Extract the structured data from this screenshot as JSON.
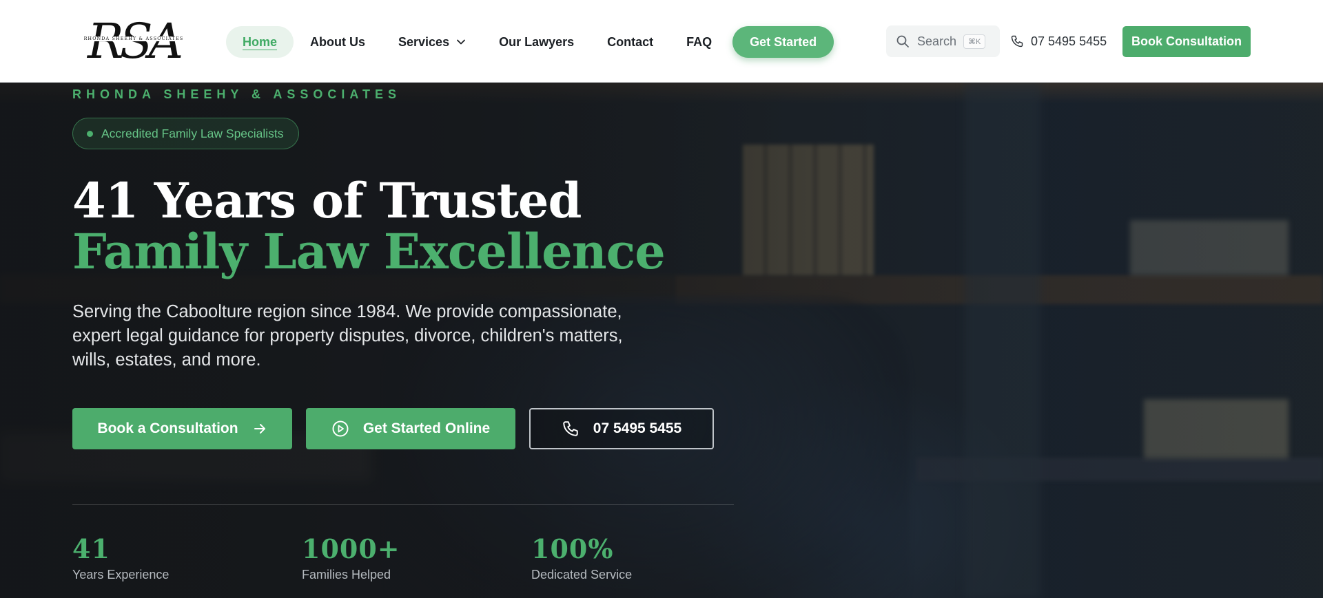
{
  "header": {
    "logo_monogram": "RSA",
    "logo_text": "RHONDA SHEEHY & ASSOCIATES",
    "nav": [
      {
        "label": "Home"
      },
      {
        "label": "About Us"
      },
      {
        "label": "Services"
      },
      {
        "label": "Our Lawyers"
      },
      {
        "label": "Contact"
      },
      {
        "label": "FAQ"
      }
    ],
    "nav_cta": "Get Started",
    "search_placeholder": "Search",
    "search_shortcut": "⌘K",
    "phone": "07 5495 5455",
    "book_button": "Book Consultation"
  },
  "hero": {
    "eyebrow": "RHONDA SHEEHY & ASSOCIATES",
    "badge": "Accredited Family Law Specialists",
    "title_line1": "41 Years of Trusted",
    "title_line2": "Family Law Excellence",
    "lead": "Serving the Caboolture region since 1984. We provide compassionate, expert legal guidance for property disputes, divorce, children's matters, wills, estates, and more.",
    "buttons": {
      "book": "Book a Consultation",
      "online": "Get Started Online",
      "call": "07 5495 5455"
    },
    "stats": [
      {
        "value": "41",
        "label": "Years Experience"
      },
      {
        "value": "1000+",
        "label": "Families Helped"
      },
      {
        "value": "100%",
        "label": "Dedicated Service"
      }
    ]
  },
  "colors": {
    "accent": "#4cb06e",
    "accent_button": "#4dac6c",
    "header_bg": "#ffffff",
    "hero_bg": "#1c2126"
  },
  "icons": {
    "search": "search-icon",
    "phone": "phone-icon",
    "chevron": "chevron-down-icon",
    "arrow": "arrow-right-icon",
    "play": "play-circle-icon"
  }
}
